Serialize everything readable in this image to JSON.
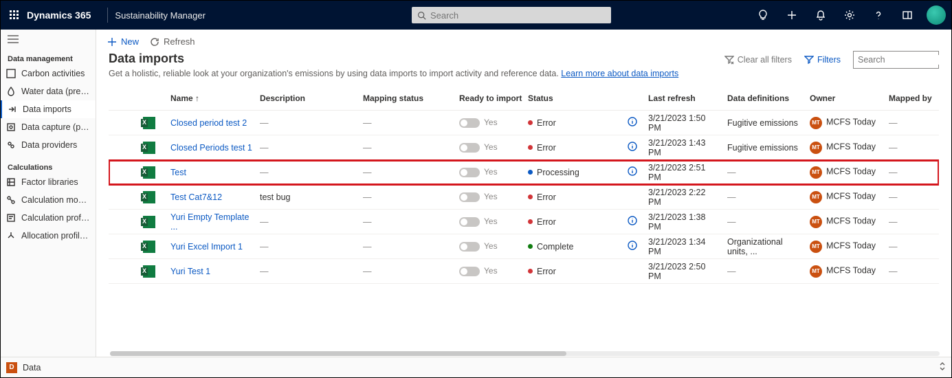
{
  "topbar": {
    "brand": "Dynamics 365",
    "app": "Sustainability Manager",
    "search_placeholder": "Search"
  },
  "sidebar": {
    "section1": "Data management",
    "section2": "Calculations",
    "items1": [
      {
        "label": "Carbon activities"
      },
      {
        "label": "Water data (preview)"
      },
      {
        "label": "Data imports"
      },
      {
        "label": "Data capture (preview)"
      },
      {
        "label": "Data providers"
      }
    ],
    "items2": [
      {
        "label": "Factor libraries"
      },
      {
        "label": "Calculation models"
      },
      {
        "label": "Calculation profiles"
      },
      {
        "label": "Allocation profiles (p..."
      }
    ]
  },
  "cmdbar": {
    "new": "New",
    "refresh": "Refresh"
  },
  "page": {
    "title": "Data imports",
    "desc": "Get a holistic, reliable look at your organization's emissions by using data imports to import activity and reference data. ",
    "learn": "Learn more about data imports",
    "clear": "Clear all filters",
    "filters": "Filters",
    "search_placeholder": "Search"
  },
  "grid": {
    "cols": {
      "name": "Name ↑",
      "desc": "Description",
      "mapping": "Mapping status",
      "ready": "Ready to import",
      "status": "Status",
      "refresh": "Last refresh",
      "defs": "Data definitions",
      "owner": "Owner",
      "mapped": "Mapped by"
    },
    "ready_yes": "Yes",
    "owner_initials": "MT",
    "rows": [
      {
        "name": "Closed period test 2",
        "desc": "—",
        "mapping": "—",
        "status": "Error",
        "dot": "red",
        "info": true,
        "refresh": "3/21/2023 1:50 PM",
        "defs": "Fugitive emissions",
        "owner": "MCFS Today",
        "mapped": "—"
      },
      {
        "name": "Closed Periods test 1",
        "desc": "—",
        "mapping": "—",
        "status": "Error",
        "dot": "red",
        "info": true,
        "refresh": "3/21/2023 1:43 PM",
        "defs": "Fugitive emissions",
        "owner": "MCFS Today",
        "mapped": "—"
      },
      {
        "name": "Test",
        "desc": "—",
        "mapping": "—",
        "status": "Processing",
        "dot": "blue",
        "info": true,
        "refresh": "3/21/2023 2:51 PM",
        "defs": "—",
        "owner": "MCFS Today",
        "mapped": "—",
        "highlight": true
      },
      {
        "name": "Test Cat7&12",
        "desc": "test bug",
        "mapping": "—",
        "status": "Error",
        "dot": "red",
        "info": false,
        "refresh": "3/21/2023 2:22 PM",
        "defs": "—",
        "owner": "MCFS Today",
        "mapped": "—"
      },
      {
        "name": "Yuri Empty Template ...",
        "desc": "—",
        "mapping": "—",
        "status": "Error",
        "dot": "red",
        "info": true,
        "refresh": "3/21/2023 1:38 PM",
        "defs": "—",
        "owner": "MCFS Today",
        "mapped": "—"
      },
      {
        "name": "Yuri Excel Import 1",
        "desc": "—",
        "mapping": "—",
        "status": "Complete",
        "dot": "green",
        "info": true,
        "refresh": "3/21/2023 1:34 PM",
        "defs": "Organizational units, ...",
        "owner": "MCFS Today",
        "mapped": "—"
      },
      {
        "name": "Yuri Test 1",
        "desc": "—",
        "mapping": "—",
        "status": "Error",
        "dot": "red",
        "info": false,
        "refresh": "3/21/2023 2:50 PM",
        "defs": "—",
        "owner": "MCFS Today",
        "mapped": "—"
      }
    ]
  },
  "bottom": {
    "area_initial": "D",
    "area": "Data"
  }
}
